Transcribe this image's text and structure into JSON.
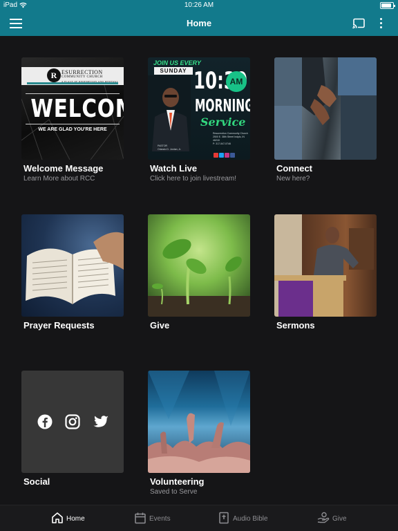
{
  "status_bar": {
    "carrier": "iPad",
    "time": "10:26 AM",
    "battery_percent": 90
  },
  "app_bar": {
    "title": "Home",
    "background_color": "#127a8c",
    "icons": [
      "menu-icon",
      "cast-icon",
      "more-vertical-icon"
    ]
  },
  "tiles": [
    {
      "title": "Welcome Message",
      "subtitle": "Learn More about RCC",
      "image": {
        "logo_letter": "R",
        "church_name_line1": "ESURRECTION",
        "church_name_line2": "COMMUNITY CHURCH",
        "church_name_line3": "A PLACE OF REDEMPTION AND RENEWAL",
        "headline": "WELCOME",
        "tagline": "WE ARE GLAD YOU'RE HERE"
      }
    },
    {
      "title": "Watch Live",
      "subtitle": "Click here to join livestream!",
      "image": {
        "join": "JOIN US EVERY",
        "day": "SUNDAY",
        "time": "10:30",
        "am": "AM",
        "morning": "MORNING",
        "service": "Service",
        "address_line1": "Resurrection Community Church",
        "address_line2": "2500 E. 38th Street Indpls, IN",
        "address_line3": "46218",
        "phone": "P: 317-547-5746",
        "pastor_title": "PASTOR",
        "pastor_name": "Orlando D. Jordan, Jr."
      }
    },
    {
      "title": "Connect",
      "subtitle": "New here?"
    },
    {
      "title": "Prayer Requests",
      "subtitle": ""
    },
    {
      "title": "Give",
      "subtitle": ""
    },
    {
      "title": "Sermons",
      "subtitle": ""
    },
    {
      "title": "Social",
      "subtitle": "",
      "icons": [
        "facebook-icon",
        "instagram-icon",
        "twitter-icon"
      ]
    },
    {
      "title": "Volunteering",
      "subtitle": "Saved to Serve"
    }
  ],
  "bottom_nav": {
    "items": [
      {
        "label": "Home",
        "icon": "home-icon",
        "active": true
      },
      {
        "label": "Events",
        "icon": "calendar-icon",
        "active": false
      },
      {
        "label": "Audio Bible",
        "icon": "bible-icon",
        "active": false
      },
      {
        "label": "Give",
        "icon": "give-hand-icon",
        "active": false
      }
    ]
  }
}
